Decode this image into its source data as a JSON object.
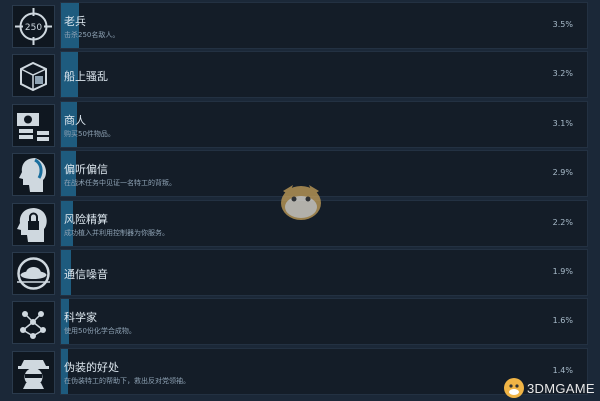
{
  "achievements": [
    {
      "title": "老兵",
      "desc": "击杀250名敌人。",
      "percent": "3.5%",
      "fill": 0.035,
      "icon": "crosshair-250-icon"
    },
    {
      "title": "船上骚乱",
      "desc": "",
      "percent": "3.2%",
      "fill": 0.032,
      "icon": "cube-icon"
    },
    {
      "title": "商人",
      "desc": "购买50件物品。",
      "percent": "3.1%",
      "fill": 0.031,
      "icon": "money-stack-icon"
    },
    {
      "title": "偏听偏信",
      "desc": "在战术任务中见证一名特工的背叛。",
      "percent": "2.9%",
      "fill": 0.029,
      "icon": "head-profile-icon"
    },
    {
      "title": "风险精算",
      "desc": "成功植入并利用控制器为你服务。",
      "percent": "2.2%",
      "fill": 0.022,
      "icon": "head-lock-icon"
    },
    {
      "title": "通信噪音",
      "desc": "",
      "percent": "1.9%",
      "fill": 0.019,
      "icon": "ufo-icon"
    },
    {
      "title": "科学家",
      "desc": "使用50份化学合成物。",
      "percent": "1.6%",
      "fill": 0.016,
      "icon": "molecule-icon"
    },
    {
      "title": "伪装的好处",
      "desc": "在伪装特工的帮助下，救出反对党领袖。",
      "percent": "1.4%",
      "fill": 0.014,
      "icon": "spy-icon"
    }
  ],
  "watermark": {
    "site": "3DMGAME"
  },
  "colors": {
    "background": "#1b2838",
    "bar": "#1e5b7e",
    "panel": "#141d28"
  }
}
